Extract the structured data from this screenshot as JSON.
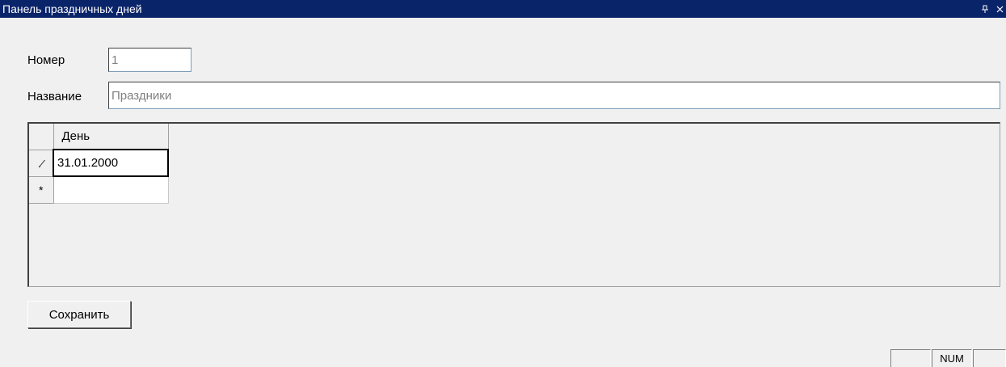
{
  "window": {
    "title": "Панель праздничных дней",
    "pin_glyph": "ᵽ",
    "close_glyph": "×"
  },
  "form": {
    "number_label": "Номер",
    "number_value": "1",
    "name_label": "Название",
    "name_value": "Праздники"
  },
  "grid": {
    "columns": [
      "День"
    ],
    "rows": [
      {
        "indicator": "pencil-icon",
        "indicator_glyph": ".⁄",
        "day": "31.01.2000"
      }
    ],
    "new_row_marker": "*"
  },
  "buttons": {
    "save_label": "Сохранить"
  },
  "statusbar": {
    "panels": [
      "",
      "NUM",
      ""
    ]
  }
}
